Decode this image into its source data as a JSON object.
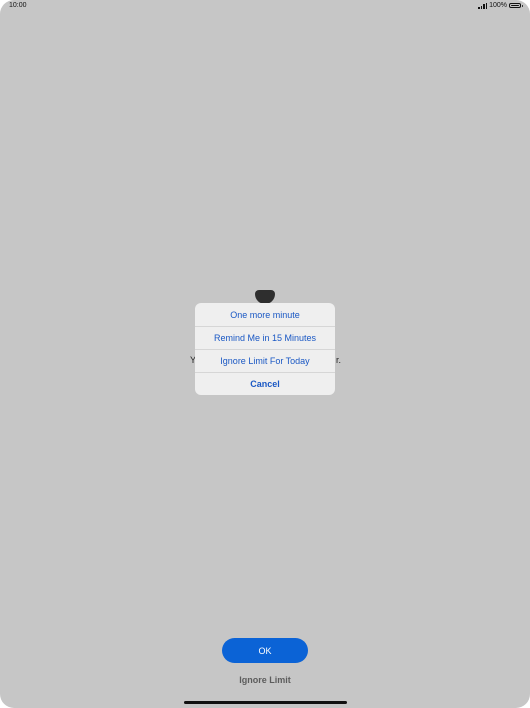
{
  "status_bar": {
    "time": "10:00",
    "battery_percent": "100%",
    "icons": [
      "signal-icon",
      "battery-icon"
    ]
  },
  "background": {
    "icon": "hourglass-icon",
    "message_left_fragment": "Y",
    "message_right_fragment": "r."
  },
  "action_sheet": {
    "items": [
      {
        "label": "One more minute"
      },
      {
        "label": "Remind Me in 15 Minutes"
      },
      {
        "label": "Ignore Limit For Today"
      },
      {
        "label": "Cancel"
      }
    ]
  },
  "footer": {
    "ok_label": "OK",
    "ignore_label": "Ignore Limit"
  },
  "colors": {
    "dim_background": "#c6c6c6",
    "sheet_background": "#efefef",
    "action_text": "#1a58c4",
    "primary_button": "#0b63d6",
    "secondary_text": "#5c5c5c"
  }
}
